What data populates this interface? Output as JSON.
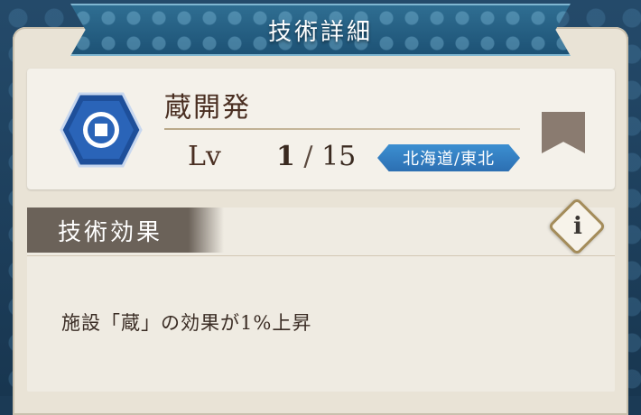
{
  "header": {
    "title": "技術詳細"
  },
  "tech": {
    "name": "蔵開発",
    "icon": "hex-coin-icon",
    "level_label": "Lv",
    "level_current": "1",
    "level_separator": "/",
    "level_max": "15",
    "region": "北海道/東北"
  },
  "effect": {
    "heading": "技術効果",
    "description": "施設「蔵」の効果が1%上昇"
  },
  "colors": {
    "banner": "#2f6e92",
    "badge": "#3c8fd1",
    "text": "#4a2f22",
    "panel": "#e9e3d6"
  }
}
